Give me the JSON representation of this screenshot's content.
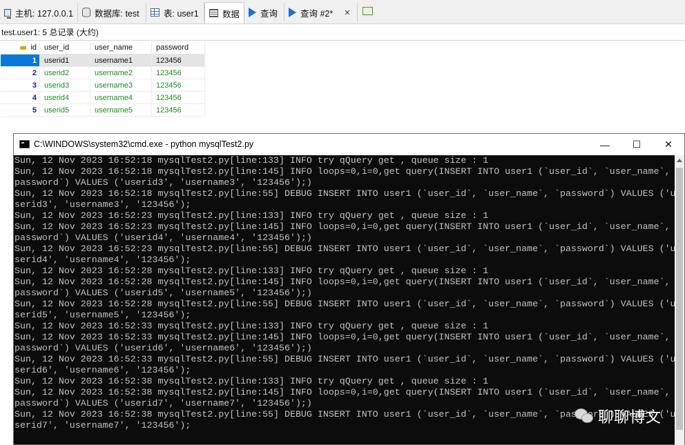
{
  "tabs": [
    {
      "icon": "host-icon",
      "label": "主机: 127.0.0.1"
    },
    {
      "icon": "database-icon",
      "label": "数据库: test"
    },
    {
      "icon": "table-icon",
      "label": "表: user1"
    },
    {
      "icon": "data-grid-icon",
      "label": "数据"
    },
    {
      "icon": "query-run-icon",
      "label": "查询"
    },
    {
      "icon": "query-run-icon",
      "label": "查询 #2*",
      "close": "✕"
    }
  ],
  "record_info": "test.user1: 5 总记录 (大约)",
  "grid": {
    "columns": [
      "id",
      "user_id",
      "user_name",
      "password"
    ],
    "rows": [
      [
        "1",
        "userid1",
        "username1",
        "123456"
      ],
      [
        "2",
        "userid2",
        "username2",
        "123456"
      ],
      [
        "3",
        "userid3",
        "username3",
        "123456"
      ],
      [
        "4",
        "userid4",
        "username4",
        "123456"
      ],
      [
        "5",
        "userid5",
        "username5",
        "123456"
      ]
    ]
  },
  "cmd": {
    "title": "C:\\WINDOWS\\system32\\cmd.exe - python  mysqlTest2.py",
    "controls": {
      "minimize": "—",
      "maximize": "☐",
      "close": "✕"
    },
    "lines": [
      "Sun, 12 Nov 2023 16:52:18 mysqlTest2.py[line:133] INFO try qQuery get , queue size : 1",
      "Sun, 12 Nov 2023 16:52:18 mysqlTest2.py[line:145] INFO loops=0,i=0,get query(INSERT INTO user1 (`user_id`, `user_name`, `",
      "password`) VALUES ('userid3', 'username3', '123456');)",
      "Sun, 12 Nov 2023 16:52:18 mysqlTest2.py[line:55] DEBUG INSERT INTO user1 (`user_id`, `user_name`, `password`) VALUES ('u",
      "serid3', 'username3', '123456');",
      "Sun, 12 Nov 2023 16:52:23 mysqlTest2.py[line:133] INFO try qQuery get , queue size : 1",
      "Sun, 12 Nov 2023 16:52:23 mysqlTest2.py[line:145] INFO loops=0,i=0,get query(INSERT INTO user1 (`user_id`, `user_name`, `",
      "password`) VALUES ('userid4', 'username4', '123456');)",
      "Sun, 12 Nov 2023 16:52:23 mysqlTest2.py[line:55] DEBUG INSERT INTO user1 (`user_id`, `user_name`, `password`) VALUES ('u",
      "serid4', 'username4', '123456');",
      "Sun, 12 Nov 2023 16:52:28 mysqlTest2.py[line:133] INFO try qQuery get , queue size : 1",
      "Sun, 12 Nov 2023 16:52:28 mysqlTest2.py[line:145] INFO loops=0,i=0,get query(INSERT INTO user1 (`user_id`, `user_name`, `",
      "password`) VALUES ('userid5', 'username5', '123456');)",
      "Sun, 12 Nov 2023 16:52:28 mysqlTest2.py[line:55] DEBUG INSERT INTO user1 (`user_id`, `user_name`, `password`) VALUES ('u",
      "serid5', 'username5', '123456');",
      "Sun, 12 Nov 2023 16:52:33 mysqlTest2.py[line:133] INFO try qQuery get , queue size : 1",
      "Sun, 12 Nov 2023 16:52:33 mysqlTest2.py[line:145] INFO loops=0,i=0,get query(INSERT INTO user1 (`user_id`, `user_name`, `",
      "password`) VALUES ('userid6', 'username6', '123456');)",
      "Sun, 12 Nov 2023 16:52:33 mysqlTest2.py[line:55] DEBUG INSERT INTO user1 (`user_id`, `user_name`, `password`) VALUES ('u",
      "serid6', 'username6', '123456');",
      "Sun, 12 Nov 2023 16:52:38 mysqlTest2.py[line:133] INFO try qQuery get , queue size : 1",
      "Sun, 12 Nov 2023 16:52:38 mysqlTest2.py[line:145] INFO loops=0,i=0,get query(INSERT INTO user1 (`user_id`, `user_name`, `",
      "password`) VALUES ('userid7', 'username7', '123456');)",
      "Sun, 12 Nov 2023 16:52:38 mysqlTest2.py[line:55] DEBUG INSERT INTO user1 (`user_id`, `user_name`, `password`) VALUES ('u",
      "serid7', 'username7', '123456');"
    ]
  },
  "watermark": {
    "text": "聊聊博文",
    "icon": "wechat-icon"
  }
}
